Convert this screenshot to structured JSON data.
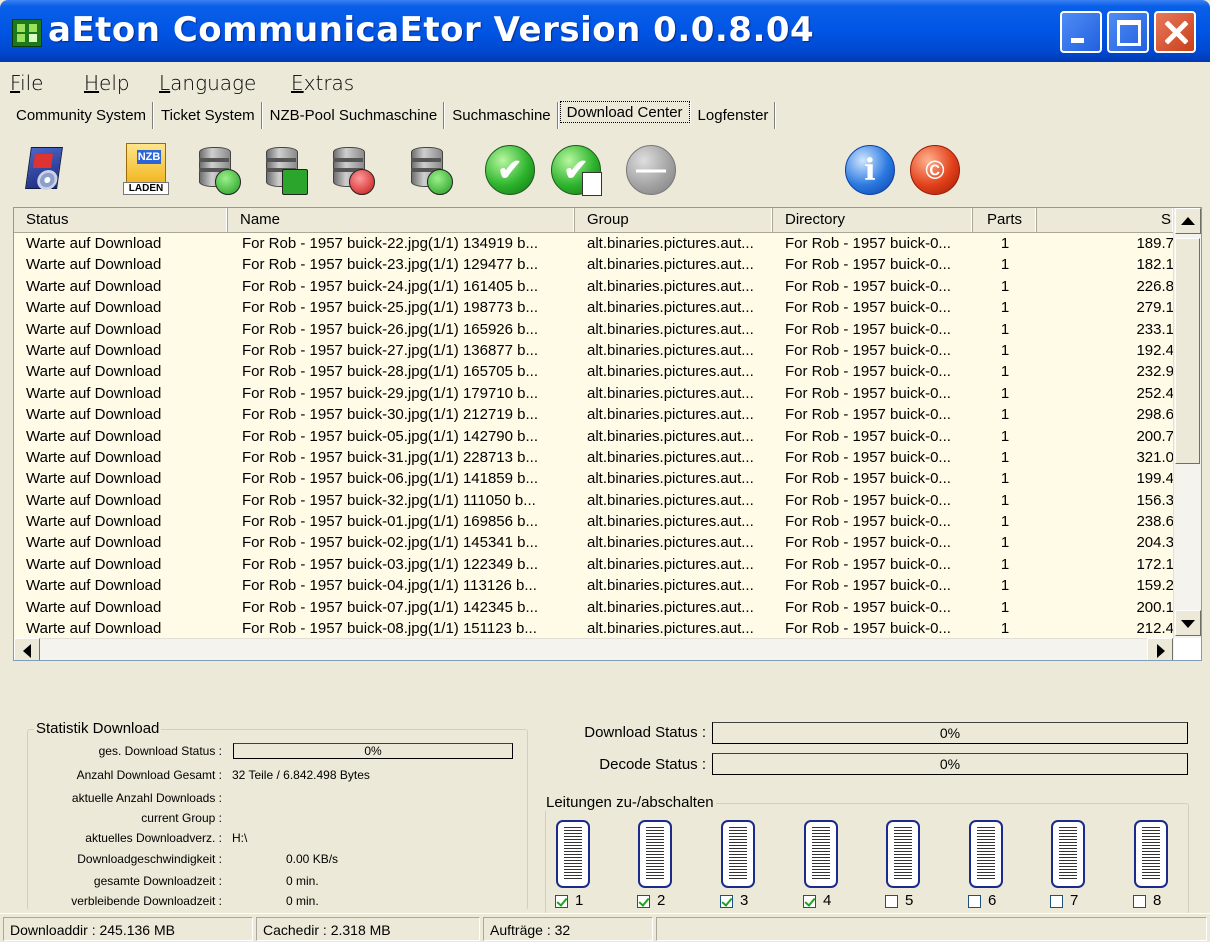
{
  "window": {
    "title": "aEton CommunicaEtor Version 0.0.8.04"
  },
  "menu": [
    "File",
    "Help",
    "Language",
    "Extras"
  ],
  "tabs": [
    "Community System",
    "Ticket System",
    "NZB-Pool Suchmaschine",
    "Suchmaschine",
    "Download Center",
    "Logfenster"
  ],
  "active_tab": "Download Center",
  "toolbar": {
    "buttons": [
      {
        "icon": "settings-icon"
      },
      {
        "icon": "nzb-load-icon",
        "label": "LADEN",
        "badge": "NZB"
      },
      {
        "icon": "db-refresh-icon"
      },
      {
        "icon": "db-add-icon"
      },
      {
        "icon": "db-delete-icon"
      },
      {
        "icon": "db-check-icon"
      },
      {
        "icon": "check-icon"
      },
      {
        "icon": "check-page-icon"
      },
      {
        "icon": "minus-icon"
      },
      {
        "icon": "info-icon"
      },
      {
        "icon": "copyright-icon"
      }
    ]
  },
  "list": {
    "columns": [
      "Status",
      "Name",
      "Group",
      "Directory",
      "Parts",
      "S"
    ],
    "rows": [
      [
        "Warte auf Download",
        "For Rob - 1957 buick-22.jpg(1/1) 134919 b...",
        "alt.binaries.pictures.aut...",
        "For Rob - 1957 buick-0...",
        "1",
        "189.7"
      ],
      [
        "Warte auf Download",
        "For Rob - 1957 buick-23.jpg(1/1) 129477 b...",
        "alt.binaries.pictures.aut...",
        "For Rob - 1957 buick-0...",
        "1",
        "182.1"
      ],
      [
        "Warte auf Download",
        "For Rob - 1957 buick-24.jpg(1/1) 161405 b...",
        "alt.binaries.pictures.aut...",
        "For Rob - 1957 buick-0...",
        "1",
        "226.8"
      ],
      [
        "Warte auf Download",
        "For Rob - 1957 buick-25.jpg(1/1) 198773 b...",
        "alt.binaries.pictures.aut...",
        "For Rob - 1957 buick-0...",
        "1",
        "279.1"
      ],
      [
        "Warte auf Download",
        "For Rob - 1957 buick-26.jpg(1/1) 165926 b...",
        "alt.binaries.pictures.aut...",
        "For Rob - 1957 buick-0...",
        "1",
        "233.1"
      ],
      [
        "Warte auf Download",
        "For Rob - 1957 buick-27.jpg(1/1) 136877 b...",
        "alt.binaries.pictures.aut...",
        "For Rob - 1957 buick-0...",
        "1",
        "192.4"
      ],
      [
        "Warte auf Download",
        "For Rob - 1957 buick-28.jpg(1/1) 165705 b...",
        "alt.binaries.pictures.aut...",
        "For Rob - 1957 buick-0...",
        "1",
        "232.9"
      ],
      [
        "Warte auf Download",
        "For Rob - 1957 buick-29.jpg(1/1) 179710 b...",
        "alt.binaries.pictures.aut...",
        "For Rob - 1957 buick-0...",
        "1",
        "252.4"
      ],
      [
        "Warte auf Download",
        "For Rob - 1957 buick-30.jpg(1/1) 212719 b...",
        "alt.binaries.pictures.aut...",
        "For Rob - 1957 buick-0...",
        "1",
        "298.6"
      ],
      [
        "Warte auf Download",
        "For Rob - 1957 buick-05.jpg(1/1) 142790 b...",
        "alt.binaries.pictures.aut...",
        "For Rob - 1957 buick-0...",
        "1",
        "200.7"
      ],
      [
        "Warte auf Download",
        "For Rob - 1957 buick-31.jpg(1/1) 228713 b...",
        "alt.binaries.pictures.aut...",
        "For Rob - 1957 buick-0...",
        "1",
        "321.0"
      ],
      [
        "Warte auf Download",
        "For Rob - 1957 buick-06.jpg(1/1) 141859 b...",
        "alt.binaries.pictures.aut...",
        "For Rob - 1957 buick-0...",
        "1",
        "199.4"
      ],
      [
        "Warte auf Download",
        "For Rob - 1957 buick-32.jpg(1/1) 111050 b...",
        "alt.binaries.pictures.aut...",
        "For Rob - 1957 buick-0...",
        "1",
        "156.3"
      ],
      [
        "Warte auf Download",
        "For Rob - 1957 buick-01.jpg(1/1) 169856 b...",
        "alt.binaries.pictures.aut...",
        "For Rob - 1957 buick-0...",
        "1",
        "238.6"
      ],
      [
        "Warte auf Download",
        "For Rob - 1957 buick-02.jpg(1/1) 145341 b...",
        "alt.binaries.pictures.aut...",
        "For Rob - 1957 buick-0...",
        "1",
        "204.3"
      ],
      [
        "Warte auf Download",
        "For Rob - 1957 buick-03.jpg(1/1) 122349 b...",
        "alt.binaries.pictures.aut...",
        "For Rob - 1957 buick-0...",
        "1",
        "172.1"
      ],
      [
        "Warte auf Download",
        "For Rob - 1957 buick-04.jpg(1/1) 113126 b...",
        "alt.binaries.pictures.aut...",
        "For Rob - 1957 buick-0...",
        "1",
        "159.2"
      ],
      [
        "Warte auf Download",
        "For Rob - 1957 buick-07.jpg(1/1) 142345 b...",
        "alt.binaries.pictures.aut...",
        "For Rob - 1957 buick-0...",
        "1",
        "200.1"
      ],
      [
        "Warte auf Download",
        "For Rob - 1957 buick-08.jpg(1/1) 151123 b...",
        "alt.binaries.pictures.aut...",
        "For Rob - 1957 buick-0...",
        "1",
        "212.4"
      ]
    ]
  },
  "stats": {
    "legend": "Statistik Download",
    "items": [
      {
        "label": "ges. Download Status :",
        "value": "0%"
      },
      {
        "label": "Anzahl Download Gesamt :",
        "value": "32 Teile / 6.842.498 Bytes"
      },
      {
        "label": "aktuelle Anzahl Downloads :",
        "value": ""
      },
      {
        "label": "current Group :",
        "value": ""
      },
      {
        "label": "aktuelles Downloadverz. :",
        "value": "H:\\"
      },
      {
        "label": "Downloadgeschwindigkeit :",
        "value": "0.00 KB/s"
      },
      {
        "label": "gesamte Downloadzeit :",
        "value": "0 min."
      },
      {
        "label": "verbleibende Downloadzeit :",
        "value": "0 min."
      }
    ]
  },
  "status_bars": {
    "download": {
      "label": "Download Status :",
      "value": "0%"
    },
    "decode": {
      "label": "Decode Status :",
      "value": "0%"
    }
  },
  "lines": {
    "legend": "Leitungen zu-/abschalten",
    "items": [
      {
        "label": "1",
        "checked": true
      },
      {
        "label": "2",
        "checked": true
      },
      {
        "label": "3",
        "checked": true
      },
      {
        "label": "4",
        "checked": true
      },
      {
        "label": "5",
        "checked": false
      },
      {
        "label": "6",
        "checked": false
      },
      {
        "label": "7",
        "checked": false
      },
      {
        "label": "8",
        "checked": false
      }
    ]
  },
  "statusbar": {
    "downloaddir": "Downloaddir :  245.136 MB",
    "cachedir": "Cachedir :    2.318 MB",
    "auftraege": "Aufträge : 32"
  },
  "colors": {
    "list_background": "#fffbe6",
    "title_blue": "#0055e5"
  }
}
